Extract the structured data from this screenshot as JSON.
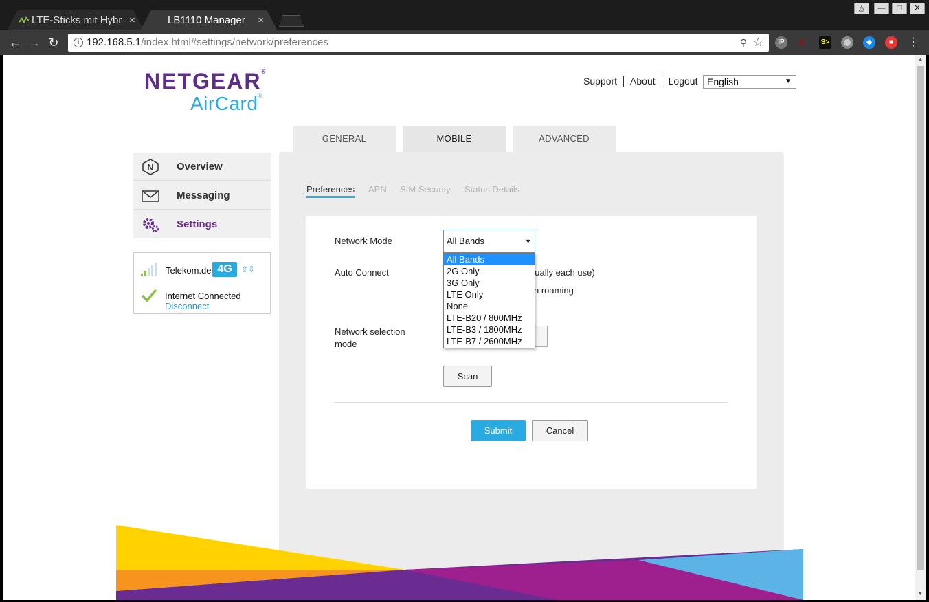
{
  "browser": {
    "tabs": [
      {
        "title": "LTE-Sticks mit Hybr",
        "active": false
      },
      {
        "title": "LB1110 Manager",
        "active": true
      }
    ],
    "close_glyph": "×",
    "url_host": "192.168.5.1",
    "url_path": "/index.html#settings/network/preferences",
    "ext_badge": "4"
  },
  "header": {
    "brand": "NETGEAR",
    "product": "AirCard",
    "links": [
      "Support",
      "About",
      "Logout"
    ],
    "language": "English"
  },
  "main_tabs": [
    "GENERAL",
    "MOBILE",
    "ADVANCED"
  ],
  "main_tabs_selected": "MOBILE",
  "sidebar": {
    "items": [
      {
        "label": "Overview",
        "icon": "netgear-n-icon"
      },
      {
        "label": "Messaging",
        "icon": "envelope-icon"
      },
      {
        "label": "Settings",
        "icon": "gears-icon"
      }
    ],
    "active": "Settings"
  },
  "status": {
    "operator": "Telekom.de",
    "network_type": "4G",
    "connection": "Internet Connected",
    "disconnect": "Disconnect"
  },
  "subtabs": [
    "Preferences",
    "APN",
    "SIM Security",
    "Status Details"
  ],
  "subtabs_selected": "Preferences",
  "form": {
    "network_mode_label": "Network Mode",
    "network_mode_value": "All Bands",
    "network_mode_options": [
      "All Bands",
      "2G Only",
      "3G Only",
      "LTE Only",
      "None",
      "LTE-B20 / 800MHz",
      "LTE-B3 / 1800MHz",
      "LTE-B7 / 2600MHz"
    ],
    "auto_connect_label": "Auto Connect",
    "auto_connect_partial_1": "nually each use)",
    "auto_connect_partial_2": "n roaming",
    "network_selection_label": "Network selection mode",
    "scan_label": "Scan",
    "submit_label": "Submit",
    "cancel_label": "Cancel"
  },
  "colors": {
    "brand_purple": "#5d2d8b",
    "accent_blue": "#29abe2",
    "deco_yellow": "#ffd200",
    "deco_orange": "#f7941d",
    "deco_magenta": "#9e1f8e",
    "deco_cyan": "#5bb4e5"
  }
}
